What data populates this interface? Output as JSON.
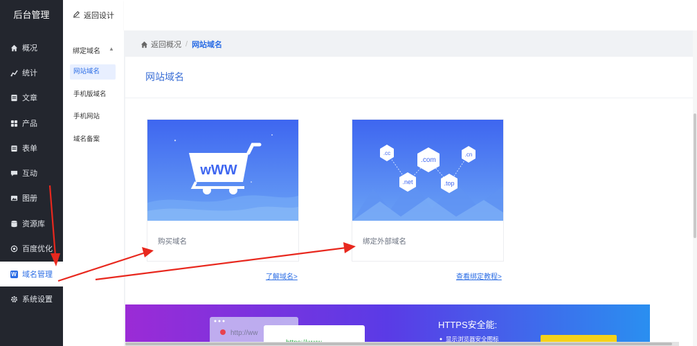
{
  "app": {
    "brand": "后台管理"
  },
  "sidebar": {
    "items": [
      {
        "label": "概况",
        "icon": "home-icon"
      },
      {
        "label": "统计",
        "icon": "chart-icon"
      },
      {
        "label": "文章",
        "icon": "article-icon"
      },
      {
        "label": "产品",
        "icon": "grid-icon"
      },
      {
        "label": "表单",
        "icon": "form-icon"
      },
      {
        "label": "互动",
        "icon": "chat-icon"
      },
      {
        "label": "图册",
        "icon": "album-icon"
      },
      {
        "label": "资源库",
        "icon": "database-icon"
      },
      {
        "label": "百度优化",
        "icon": "seo-icon"
      },
      {
        "label": "域名管理",
        "icon": "w-icon",
        "active": true
      },
      {
        "label": "系统设置",
        "icon": "gear-icon"
      }
    ]
  },
  "subnav": {
    "back_label": "返回设计",
    "group_label": "绑定域名",
    "items": [
      {
        "label": "网站域名",
        "active": true
      },
      {
        "label": "手机版域名"
      },
      {
        "label": "手机网站"
      },
      {
        "label": "域名备案"
      }
    ]
  },
  "breadcrumb": {
    "home": "返回概况",
    "separator": "/",
    "current": "网站域名"
  },
  "panel": {
    "title": "网站域名",
    "cards": [
      {
        "label": "购买域名",
        "link": "了解域名>",
        "image": "shopping-cart-www-illustration"
      },
      {
        "label": "绑定外部域名",
        "link": "查看绑定教程>",
        "image": "domain-extensions-illustration"
      }
    ],
    "tlds": [
      ".cc",
      ".com",
      ".cn",
      ".net",
      ".top"
    ],
    "cart_text": "wWW"
  },
  "banner": {
    "title": "HTTPS安全能:",
    "bullet": "显示浏览器安全图标",
    "url_text_1": "http://ww",
    "url_text_2": "https://www."
  },
  "colors": {
    "accent": "#2b6de5",
    "sidebar_bg": "#23262e",
    "arrow": "#e8281e"
  }
}
